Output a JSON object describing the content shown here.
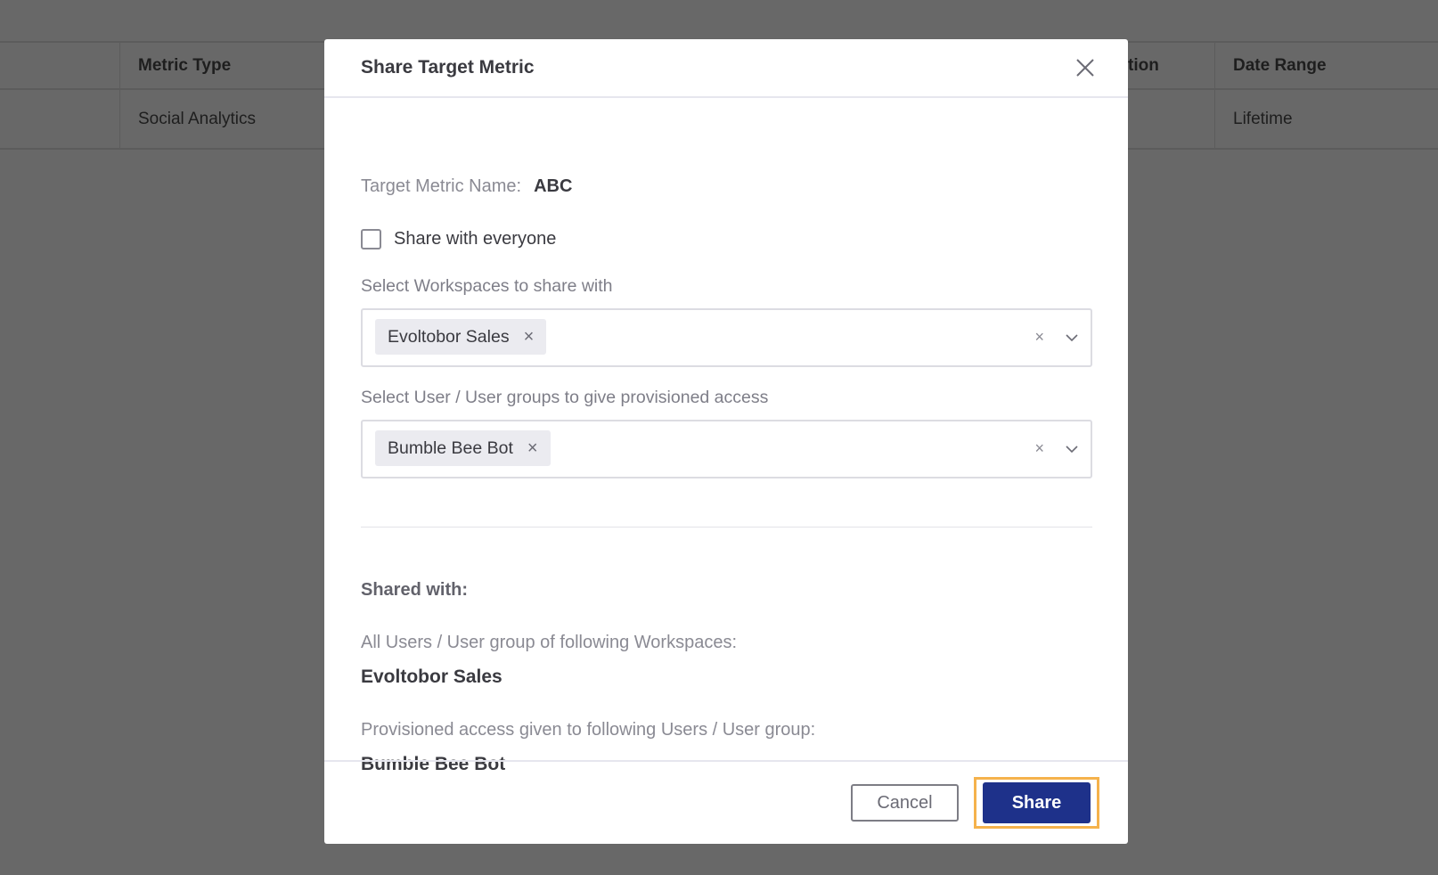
{
  "background_table": {
    "headers": [
      "Metric Type",
      "tion",
      "Date Range"
    ],
    "row": [
      "Social Analytics",
      "Lifetime"
    ]
  },
  "modal": {
    "title": "Share Target Metric",
    "name_label": "Target Metric Name:",
    "name_value": "ABC",
    "share_everyone_label": "Share with everyone",
    "share_everyone_checked": false,
    "workspaces_label": "Select Workspaces to share with",
    "workspaces_tags": [
      "Evoltobor Sales"
    ],
    "users_label": "Select User / User groups to give provisioned access",
    "users_tags": [
      "Bumble Bee Bot"
    ],
    "tag_remove": "×",
    "clear_all": "×",
    "shared_with_title": "Shared with:",
    "workspaces_info": "All Users / User group of following Workspaces:",
    "workspaces_value": "Evoltobor Sales",
    "users_info": "Provisioned access given to following Users / User group:",
    "users_value": "Bumble Bee Bot",
    "cancel_label": "Cancel",
    "share_label": "Share"
  },
  "colors": {
    "primary": "#1e318a",
    "highlight": "#f5b24c",
    "overlay": "#686868"
  }
}
